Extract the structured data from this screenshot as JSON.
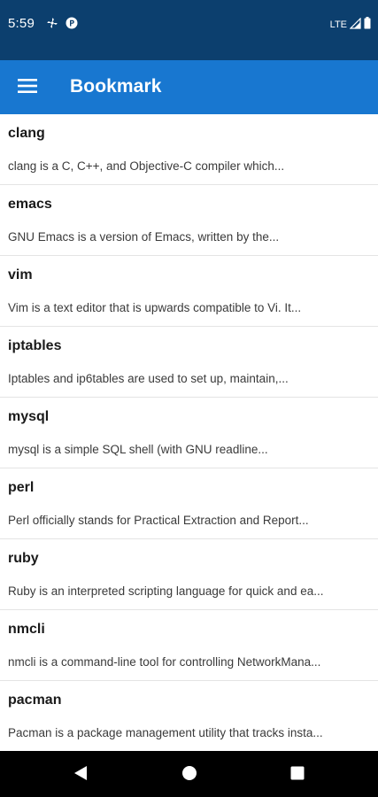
{
  "status_bar": {
    "time": "5:59",
    "network": "LTE",
    "icons": [
      "fan-icon",
      "p-icon",
      "signal-icon",
      "battery-icon"
    ]
  },
  "app_bar": {
    "menu_icon": "hamburger-menu-icon",
    "title": "Bookmark"
  },
  "bookmarks": [
    {
      "title": "clang",
      "description": "clang is a C, C++, and Objective-C compiler which..."
    },
    {
      "title": "emacs",
      "description": "GNU Emacs is a version of Emacs, written by the..."
    },
    {
      "title": "vim",
      "description": "Vim is a text editor that is upwards compatible to Vi. It..."
    },
    {
      "title": "iptables",
      "description": "Iptables and ip6tables are used to set up, maintain,..."
    },
    {
      "title": "mysql",
      "description": "mysql is a simple SQL shell (with GNU readline..."
    },
    {
      "title": "perl",
      "description": "Perl officially stands for Practical Extraction and Report..."
    },
    {
      "title": "ruby",
      "description": "Ruby is an interpreted scripting language for quick and ea..."
    },
    {
      "title": "nmcli",
      "description": "nmcli is a command-line tool for controlling NetworkMana..."
    },
    {
      "title": "pacman",
      "description": "Pacman is a package management utility that tracks insta..."
    }
  ],
  "nav_bar": {
    "buttons": [
      "back-icon",
      "home-icon",
      "recents-icon"
    ]
  },
  "colors": {
    "status_bar": "#0c3f6e",
    "app_bar": "#1877d0",
    "nav_bar": "#000000"
  }
}
